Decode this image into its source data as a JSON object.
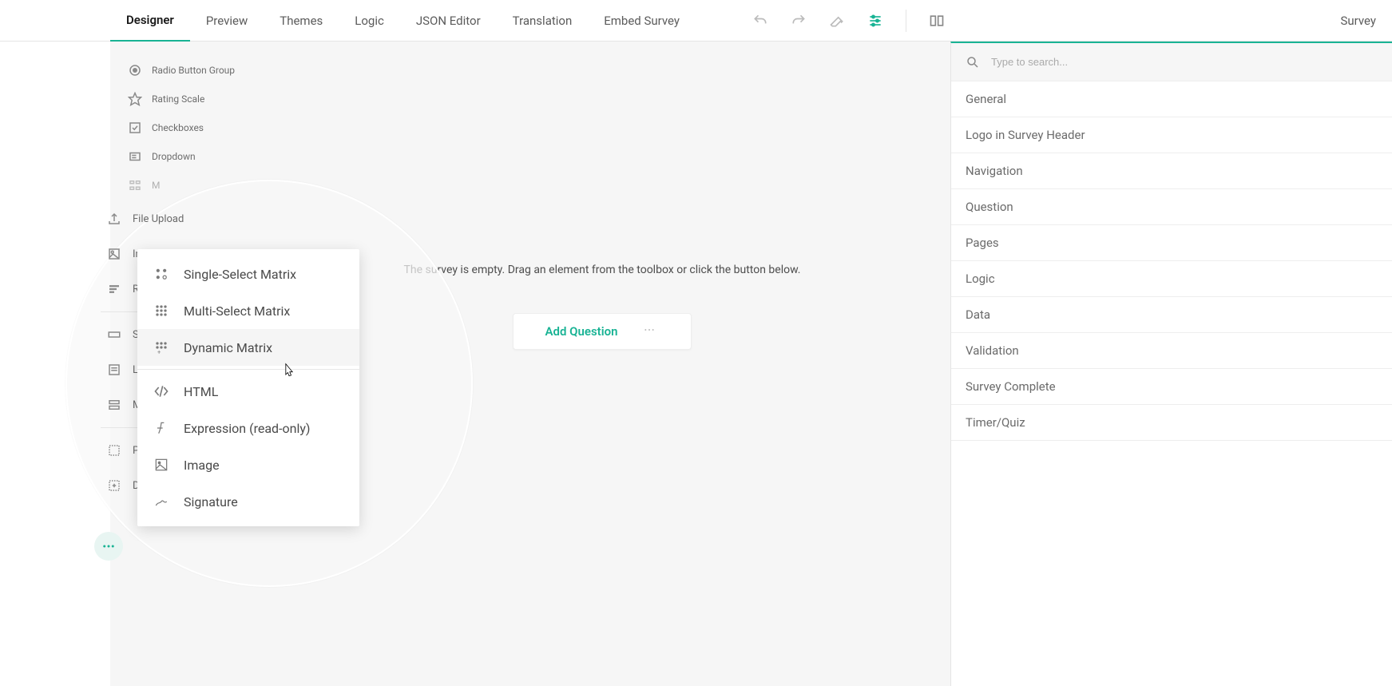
{
  "tabs": {
    "designer": "Designer",
    "preview": "Preview",
    "themes": "Themes",
    "logic": "Logic",
    "json": "JSON Editor",
    "translation": "Translation",
    "embed": "Embed Survey"
  },
  "topright_label": "Survey",
  "toolbox": {
    "radio": "Radio Button Group",
    "rating": "Rating Scale",
    "checkboxes": "Checkboxes",
    "dropdown": "Dropdown",
    "mul": "M",
    "file_upload": "File Upload",
    "image_picker": "Image Picker",
    "ra": "Ra",
    "si": "Si",
    "lo": "Lo",
    "m": "M",
    "pa": "Pa",
    "dy": "Dy"
  },
  "popup": {
    "single_matrix": "Single-Select Matrix",
    "multi_matrix": "Multi-Select Matrix",
    "dynamic_matrix": "Dynamic Matrix",
    "html": "HTML",
    "expression": "Expression (read-only)",
    "image": "Image",
    "signature": "Signature"
  },
  "canvas": {
    "empty": "The survey is empty. Drag an element from the toolbox or click the button below.",
    "add_question": "Add Question"
  },
  "rightpanel": {
    "search_placeholder": "Type to search...",
    "sections": {
      "general": "General",
      "logo": "Logo in Survey Header",
      "navigation": "Navigation",
      "question": "Question",
      "pages": "Pages",
      "logic": "Logic",
      "data": "Data",
      "validation": "Validation",
      "complete": "Survey Complete",
      "timer": "Timer/Quiz"
    }
  }
}
